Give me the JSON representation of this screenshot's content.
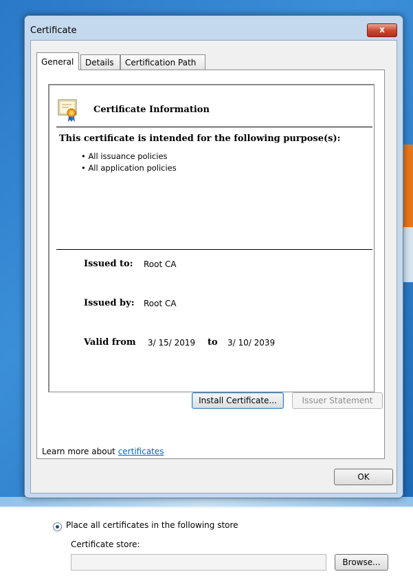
{
  "window": {
    "title": "Certificate",
    "close_label": "x"
  },
  "tabs": [
    {
      "label": "General"
    },
    {
      "label": "Details"
    },
    {
      "label": "Certification Path"
    }
  ],
  "info": {
    "title": "Certificate Information",
    "purpose_heading": "This certificate is intended for the following purpose(s):",
    "purposes": [
      "• All issuance policies",
      "• All application policies"
    ],
    "issued_to_label": "Issued to:",
    "issued_to_value": "Root CA",
    "issued_by_label": "Issued by:",
    "issued_by_value": "Root CA",
    "valid_from_label": "Valid from",
    "valid_from_value": "3/ 15/ 2019",
    "valid_to_label": "to",
    "valid_to_value": "3/ 10/ 2039"
  },
  "buttons": {
    "install": "Install Certificate...",
    "issuer_statement": "Issuer Statement",
    "ok": "OK",
    "browse": "Browse..."
  },
  "learn_more": {
    "prefix": "Learn more about ",
    "link": "certificates"
  },
  "wizard": {
    "radio_label": "Place all certificates in the following store",
    "store_label": "Certificate store:",
    "store_value": ""
  },
  "colors": {
    "desktop": "#2a78c8",
    "window_frame": "#c5d9ee",
    "close_button": "#c9462c",
    "link": "#0066cc"
  },
  "icons": {
    "certificate": "certificate-icon",
    "close": "close-icon"
  }
}
